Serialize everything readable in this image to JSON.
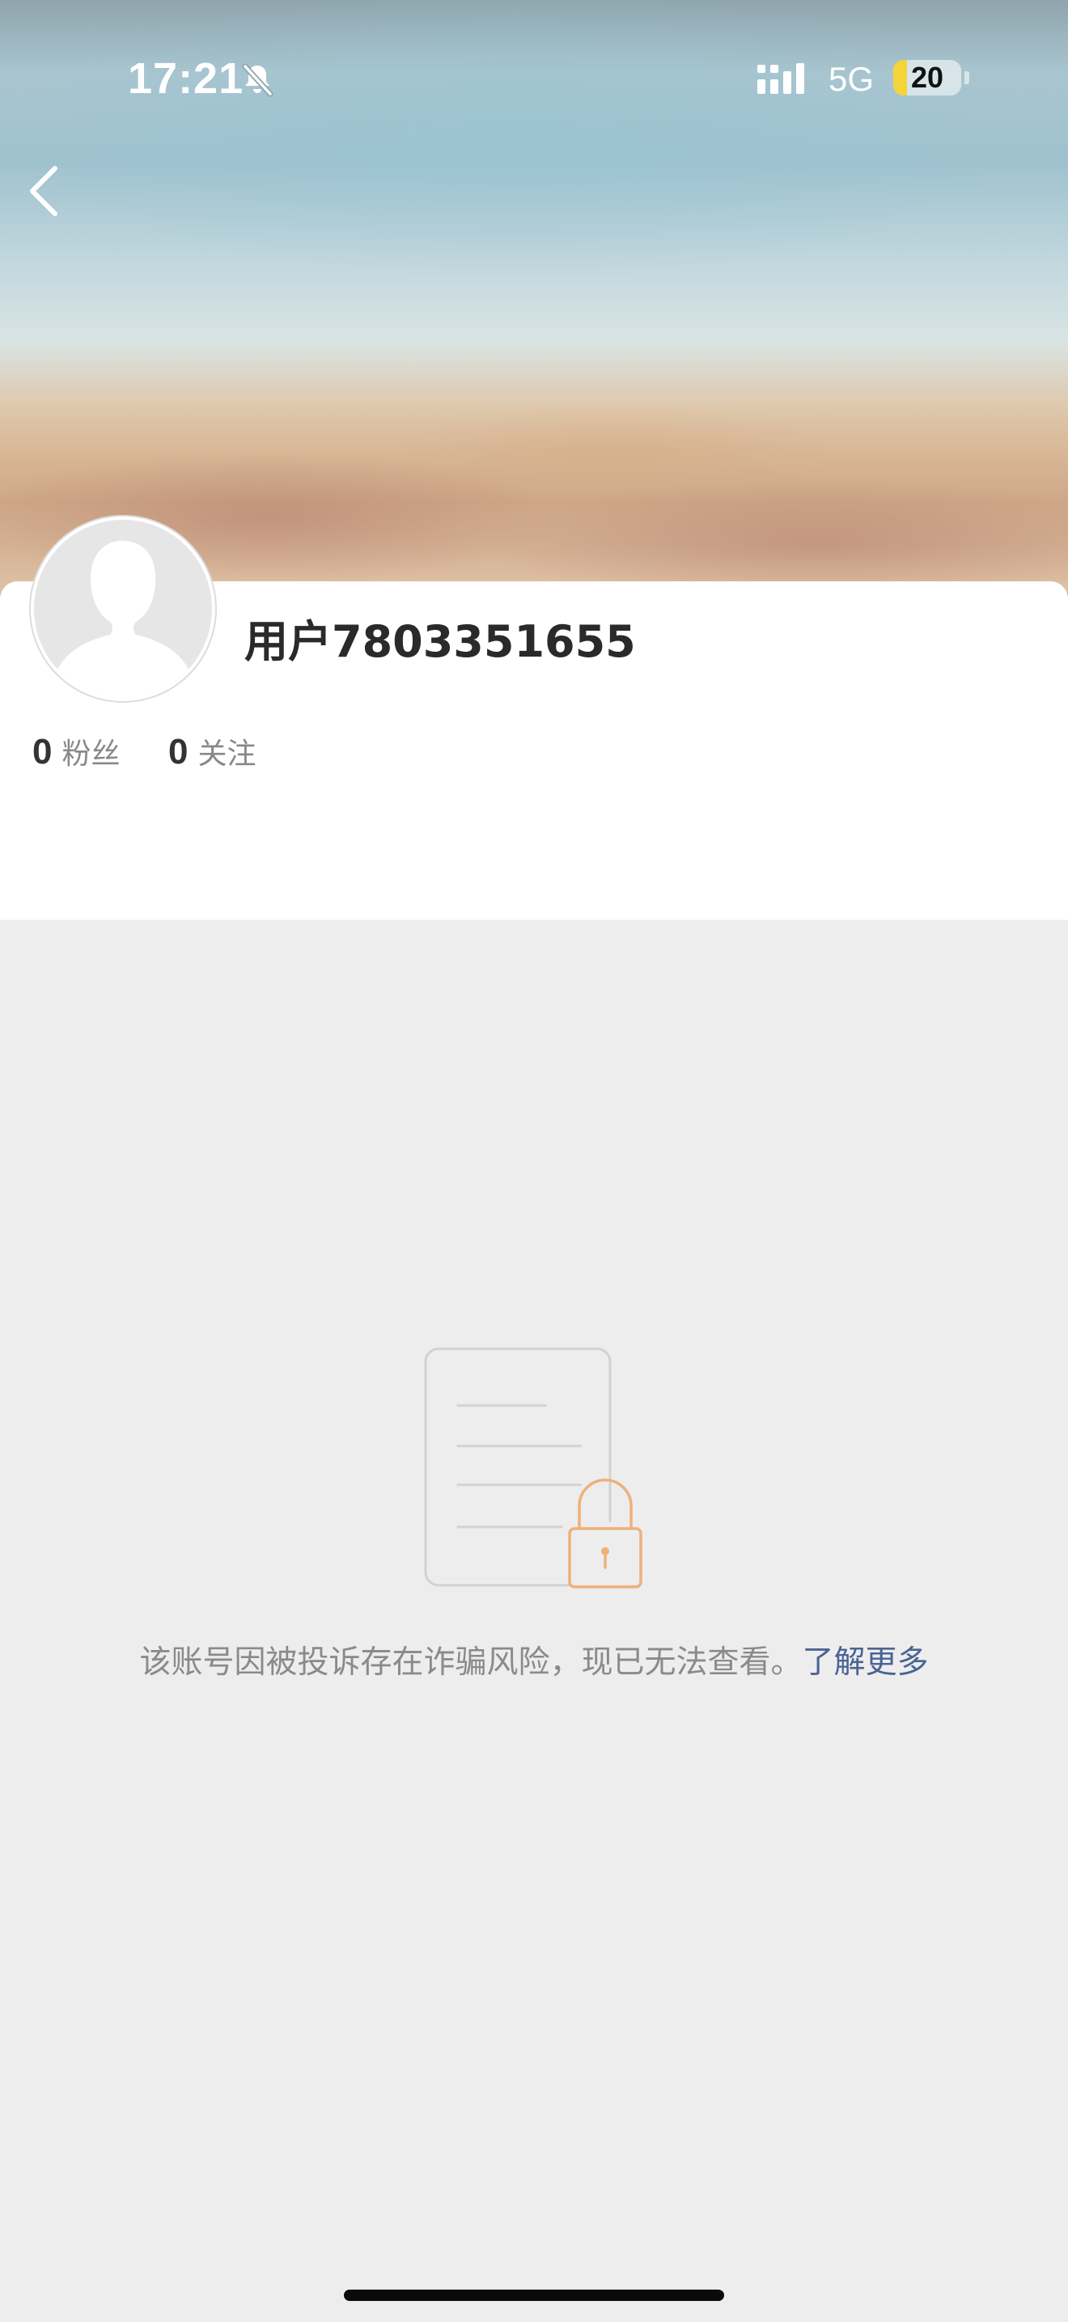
{
  "status_bar": {
    "time": "17:21",
    "network": "5G",
    "battery_level": "20",
    "battery_fraction": 0.2,
    "silent_icon": "bell-slash-icon",
    "signal_icon": "cellular-signal-icon"
  },
  "nav": {
    "back_icon": "chevron-left-icon"
  },
  "profile": {
    "username": "用户7803351655",
    "avatar_icon": "default-avatar-silhouette-icon",
    "stats": [
      {
        "count": "0",
        "label": "粉丝"
      },
      {
        "count": "0",
        "label": "关注"
      }
    ]
  },
  "notice": {
    "illustration_icon": "locked-document-icon",
    "message": "该账号因被投诉存在诈骗风险，现已无法查看。",
    "learn_more": "了解更多"
  },
  "colors": {
    "page_background": "#ededed",
    "card_background": "#ffffff",
    "link": "#4a6394",
    "lock_accent": "#f0b07a",
    "battery_fill": "#f5d33b"
  }
}
